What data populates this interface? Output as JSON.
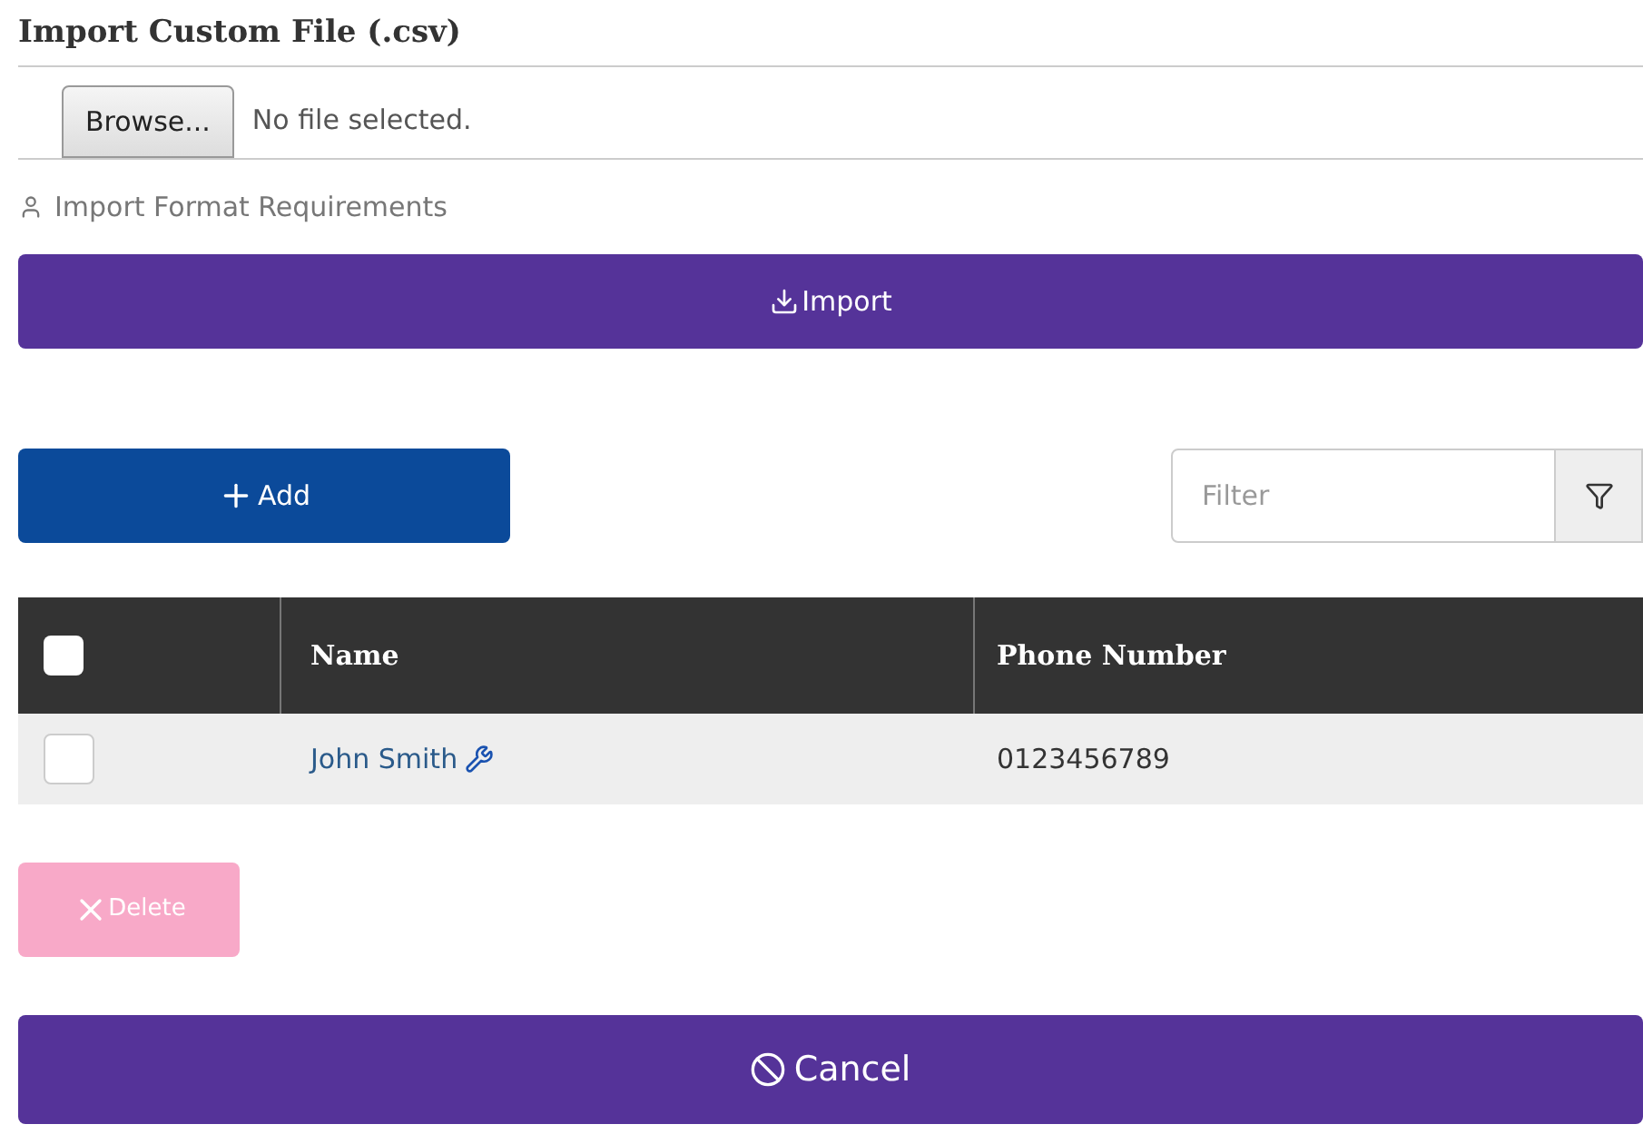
{
  "import_section": {
    "title": "Import Custom File (.csv)",
    "browse_button": "Browse...",
    "file_status": "No file selected.",
    "requirements_link": "Import Format Requirements",
    "import_button": "Import"
  },
  "toolbar": {
    "add_button": "Add",
    "filter": {
      "placeholder": "Filter"
    }
  },
  "table": {
    "select_all": {
      "checked": false
    },
    "columns": [
      "Name",
      "Phone Number"
    ],
    "rows": [
      {
        "checked": false,
        "name": "John Smith",
        "phone": "0123456789"
      }
    ]
  },
  "delete_button": {
    "label": "Delete",
    "disabled": true
  },
  "cancel_button": "Cancel"
}
